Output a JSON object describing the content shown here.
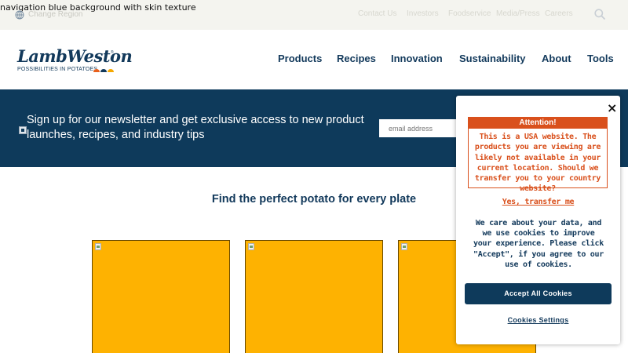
{
  "topbar": {
    "broken_image_alt": "navigation blue background with skin texture",
    "region_label": "Change Region",
    "links": [
      "Contact Us",
      "Investors",
      "Foodservice",
      "Media/Press",
      "Careers"
    ],
    "search_icon": "search-icon",
    "globe_icon": "globe-icon"
  },
  "header": {
    "logo_wordmark": "LambWeston",
    "logo_tm": "®",
    "logo_tagline": "POSSIBILITIES IN POTATOES",
    "nav": [
      "Products",
      "Recipes",
      "Innovation",
      "Sustainability",
      "About",
      "Tools"
    ]
  },
  "newsletter": {
    "text": "Sign up for our newsletter and get exclusive access to new product launches, recipes, and industry tips",
    "email_placeholder": "email address"
  },
  "main": {
    "title": "Find the perfect potato for every plate",
    "card_color": "#feb201"
  },
  "modal": {
    "close_label": "×",
    "attention_title": "Attention!",
    "attention_body": "This is a USA website. The products you are viewing are likely not available in your current location. Should we transfer you to your country website?",
    "transfer_link": "Yes, transfer me",
    "cookie_text": "We care about your data, and we use cookies to improve your experience. Please click \"Accept\", if you agree to our use of cookies.",
    "accept_button": "Accept All Cookies",
    "settings_link": "Cookies Settings"
  },
  "colors": {
    "navy": "#0e3a5b",
    "accent_orange": "#d9501c",
    "card_yellow": "#feb201"
  }
}
